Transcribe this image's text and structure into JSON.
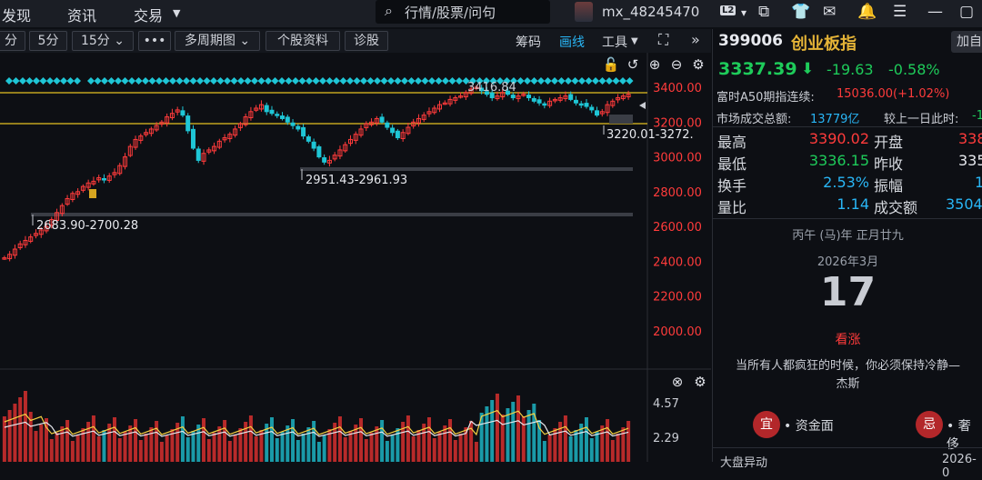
{
  "nav": {
    "discover": "发现",
    "news": "资讯",
    "trade": "交易",
    "trade_arrow": "▼"
  },
  "search": {
    "placeholder": "行情/股票/问句"
  },
  "user": {
    "name": "mx_48245470",
    "badge": "L2",
    "arrow": "▾"
  },
  "toolbar": {
    "periods": [
      "分",
      "5分",
      "15分"
    ],
    "more": "•••",
    "multi": "多周期图",
    "profile": "个股资料",
    "diagnose": "诊股",
    "chips": "筹码",
    "draw": "画线",
    "tools": "工具"
  },
  "stock": {
    "code": "399006",
    "name": "创业板指",
    "add": "加自",
    "price": "3337.39",
    "arrow": "⬇",
    "change": "-19.63",
    "pct": "-0.58%",
    "a50_label": "富时A50期指连续:",
    "a50_value": "15036.00(+1.02%)",
    "vol_label": "市场成交总额:",
    "vol_value": "13779亿",
    "cmp_label": "较上一日此时:",
    "cmp_value": "-1"
  },
  "quote_table": [
    {
      "l1": "最高",
      "v1": "3390.02",
      "c1": "red",
      "l2": "开盘",
      "v2": "338",
      "c2": "red"
    },
    {
      "l1": "最低",
      "v1": "3336.15",
      "c1": "green",
      "l2": "昨收",
      "v2": "335",
      "c2": "white"
    },
    {
      "l1": "换手",
      "v1": "2.53%",
      "c1": "blue",
      "l2": "振幅",
      "v2": "1",
      "c2": "blue"
    },
    {
      "l1": "量比",
      "v1": "1.14",
      "c1": "blue",
      "l2": "成交额",
      "v2": "3504",
      "c2": "blue"
    }
  ],
  "calendar": {
    "lunar": "丙午 (马)年 正月廿九",
    "year_month": "2026年3月",
    "day": "17",
    "outlook": "看涨",
    "quote": "当所有人都疯狂的时候，你必须保持冷静—",
    "quote2": "杰斯"
  },
  "tags": [
    {
      "icon": "宜",
      "text": "• 资金面"
    },
    {
      "icon": "忌",
      "text": "• 奢侈"
    }
  ],
  "bottom": {
    "left": "大盘异动",
    "right": "2026-0"
  },
  "chart_data": {
    "type": "candlestick",
    "y_ticks": [
      "3400.00",
      "3200.00",
      "3000.00",
      "2800.00",
      "2600.00",
      "2400.00",
      "2200.00",
      "2000.00"
    ],
    "ylim": [
      1950,
      3480
    ],
    "annotations": [
      "3416.84",
      "3220.01-3272.",
      "2951.43-2961.93",
      "2683.90-2700.28"
    ],
    "volume_ticks": [
      "4.57",
      "2.29"
    ],
    "closes": [
      2420,
      2440,
      2470,
      2500,
      2520,
      2540,
      2560,
      2580,
      2600,
      2640,
      2680,
      2720,
      2760,
      2790,
      2800,
      2830,
      2850,
      2860,
      2880,
      2870,
      2890,
      2910,
      2950,
      3000,
      3060,
      3100,
      3120,
      3140,
      3160,
      3180,
      3200,
      3230,
      3250,
      3270,
      3240,
      3150,
      3050,
      2980,
      3020,
      3040,
      3060,
      3090,
      3110,
      3130,
      3160,
      3190,
      3230,
      3260,
      3280,
      3300,
      3260,
      3250,
      3240,
      3220,
      3200,
      3180,
      3160,
      3120,
      3090,
      3050,
      3000,
      2970,
      2980,
      3010,
      3040,
      3070,
      3100,
      3130,
      3160,
      3190,
      3200,
      3220,
      3200,
      3170,
      3140,
      3110,
      3140,
      3170,
      3200,
      3220,
      3240,
      3260,
      3280,
      3300,
      3310,
      3330,
      3340,
      3350,
      3370,
      3390,
      3400,
      3380,
      3360,
      3340,
      3350,
      3370,
      3360,
      3340,
      3350,
      3360,
      3340,
      3320,
      3310,
      3300,
      3320,
      3330,
      3340,
      3350,
      3330,
      3310,
      3300,
      3290,
      3270,
      3240,
      3260,
      3300,
      3320,
      3340,
      3350,
      3360
    ]
  }
}
